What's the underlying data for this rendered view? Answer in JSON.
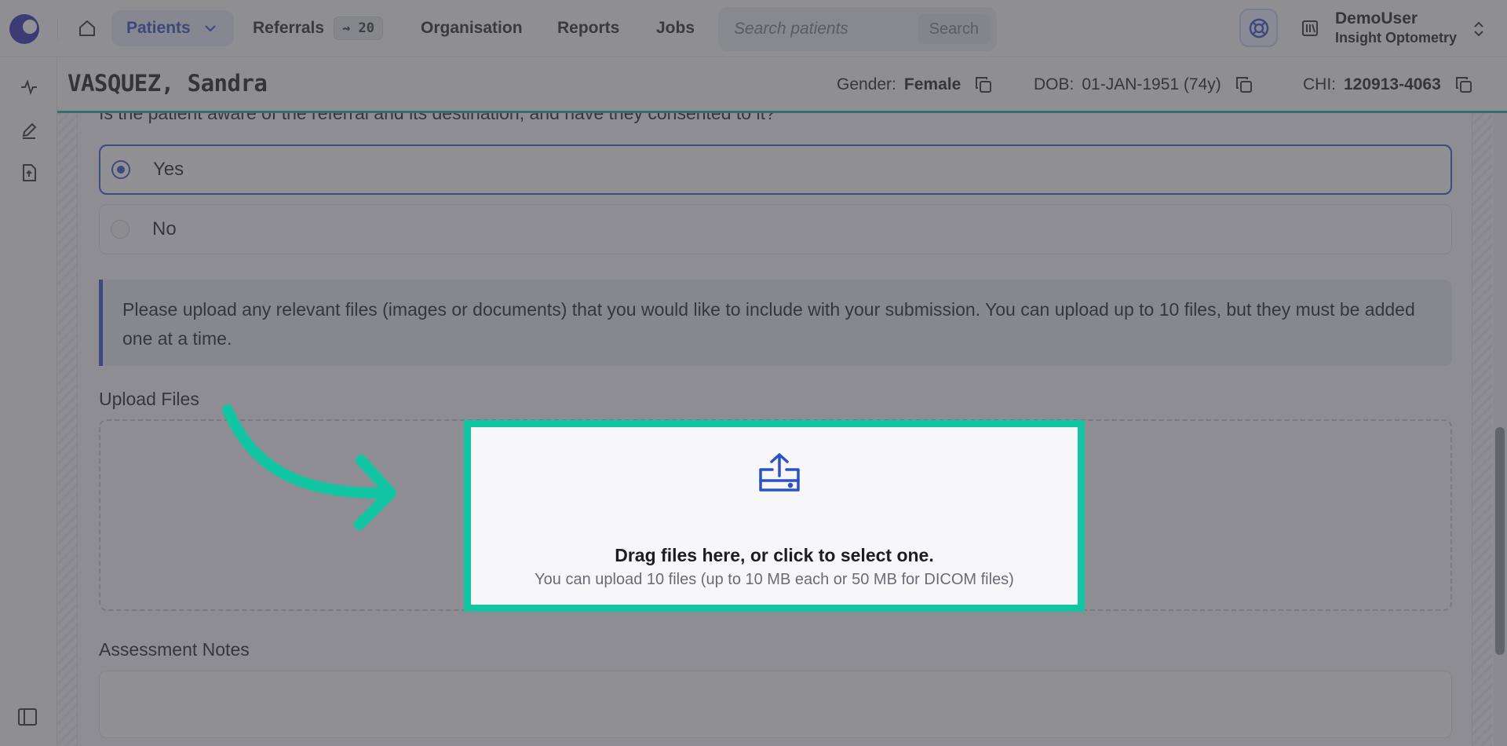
{
  "nav": {
    "patients": "Patients",
    "referrals": "Referrals",
    "referrals_badge": "⇝ 20",
    "organisation": "Organisation",
    "reports": "Reports",
    "jobs": "Jobs",
    "search_placeholder": "Search patients",
    "search_button": "Search"
  },
  "user": {
    "name": "DemoUser",
    "org": "Insight Optometry"
  },
  "patient": {
    "name": "VASQUEZ, Sandra",
    "gender_label": "Gender:",
    "gender": "Female",
    "dob_label": "DOB:",
    "dob": "01-JAN-1951 (74y)",
    "chi_label": "CHI:",
    "chi": "120913-4063"
  },
  "form": {
    "question": "Is the patient aware of the referral and its destination, and have they consented to it?",
    "options": [
      "Yes",
      "No"
    ],
    "selected": "Yes",
    "info": "Please upload any relevant files (images or documents) that you would like to include with your submission. You can upload up to 10 files, but they must be added one at a time.",
    "upload_label": "Upload Files",
    "drop_title": "Drag files here, or click to select one.",
    "drop_sub": "You can upload 10 files (up to 10 MB each or 50 MB for DICOM files)",
    "notes_label": "Assessment Notes"
  },
  "colors": {
    "accent": "#2d50c4",
    "highlight": "#12c6a3",
    "brand": "#2b2fb0"
  },
  "icons": {
    "home": "home-icon",
    "help": "lifebuoy-icon",
    "org": "library-icon",
    "activity": "activity-icon",
    "edit": "pencil-icon",
    "upload_file": "file-upload-icon",
    "copy": "copy-icon",
    "upload": "upload-icon",
    "sidebar": "sidebar-toggle-icon",
    "arrow": "curved-arrow-icon"
  }
}
